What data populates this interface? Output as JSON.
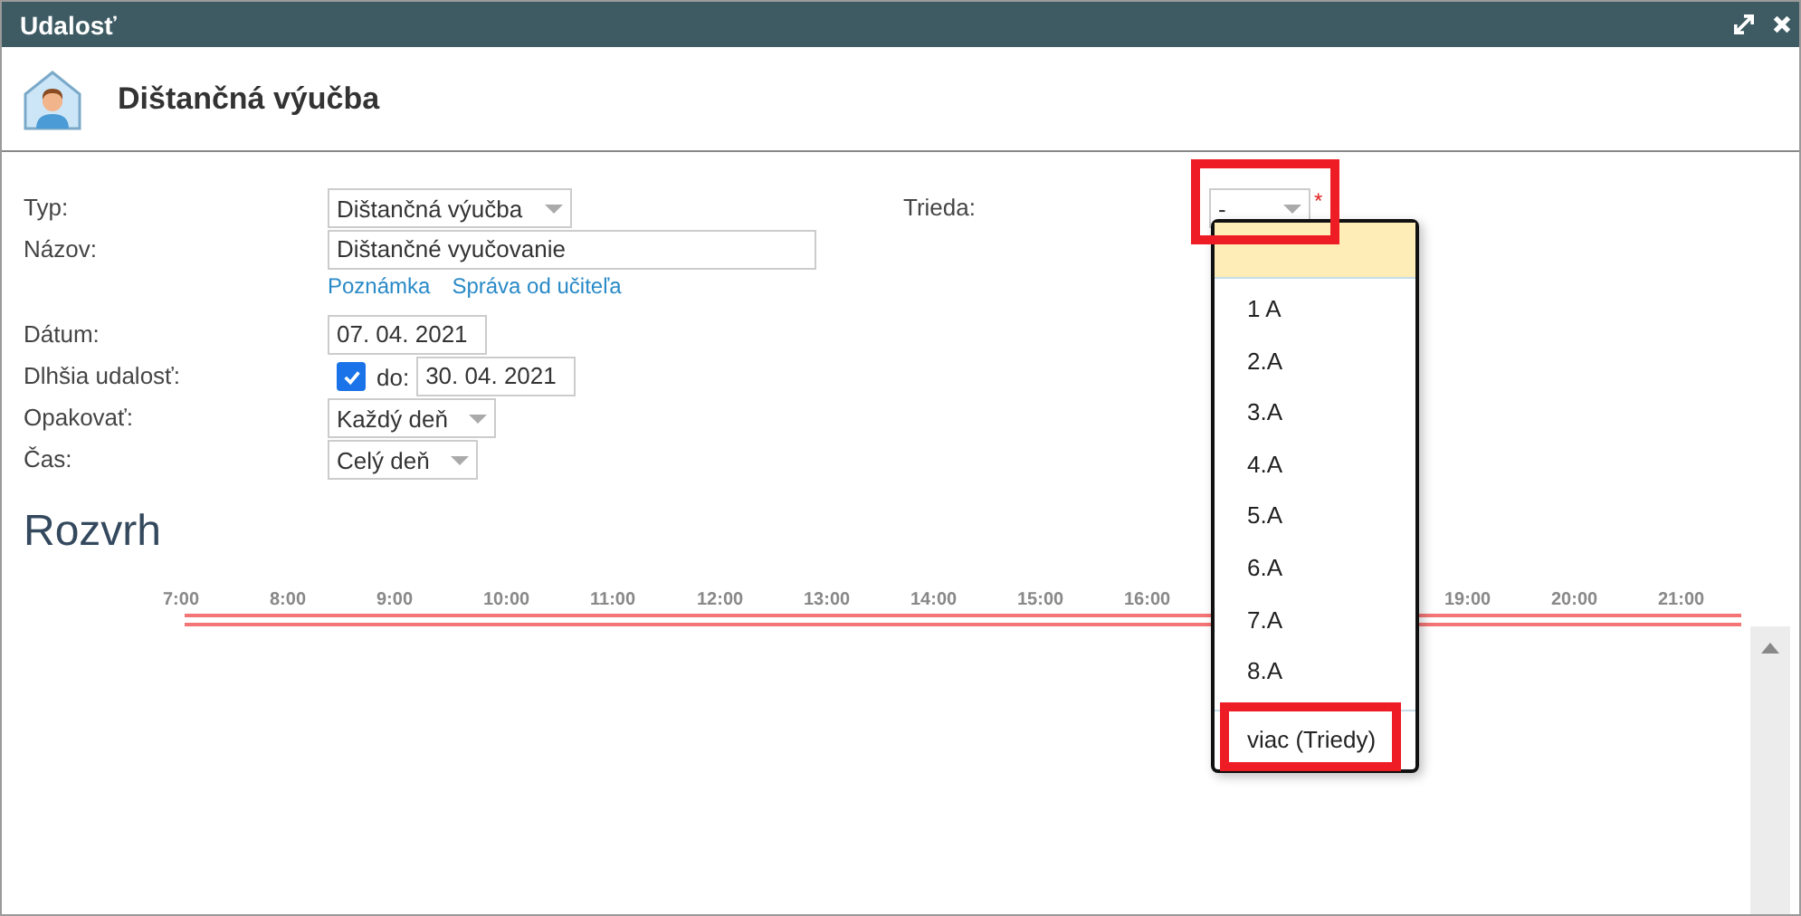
{
  "window": {
    "title": "Udalosť"
  },
  "header": {
    "title": "Dištančná výučba"
  },
  "form": {
    "fields": [
      {
        "kind": "select",
        "label": "Typ:",
        "value": "Dištančná výučba"
      },
      {
        "kind": "text",
        "label": "Názov:",
        "value": "Dištančné vyučovanie",
        "links": [
          "Poznámka",
          "Správa od učiteľa"
        ]
      },
      {
        "kind": "date",
        "label": "Dátum:",
        "value": "07. 04. 2021"
      },
      {
        "kind": "range",
        "label": "Dlhšia udalosť:",
        "checked": true,
        "to_label": "do:",
        "value": "30. 04. 2021"
      },
      {
        "kind": "select",
        "label": "Opakovať:",
        "value": "Každý deň"
      },
      {
        "kind": "select",
        "label": "Čas:",
        "value": "Celý deň"
      }
    ]
  },
  "class_field": {
    "label": "Trieda:",
    "value": "-",
    "required_mark": "*",
    "options": [
      {
        "selected": true
      },
      {
        "label": "1 A",
        "selected": false
      },
      {
        "label": "2.A",
        "selected": false
      },
      {
        "label": "3.A",
        "selected": false
      },
      {
        "label": "4.A",
        "selected": false
      },
      {
        "label": "5.A",
        "selected": false
      },
      {
        "label": "6.A",
        "selected": false
      },
      {
        "label": "7.A",
        "selected": false
      },
      {
        "label": "8.A",
        "selected": false
      }
    ],
    "more_option": "viac (Triedy)"
  },
  "schedule": {
    "title": "Rozvrh",
    "ticks": [
      "7:00",
      "8:00",
      "9:00",
      "10:00",
      "11:00",
      "12:00",
      "13:00",
      "14:00",
      "15:00",
      "16:00"
    ],
    "ticks_after_menu": [
      "19:00",
      "20:00",
      "21:00"
    ]
  }
}
